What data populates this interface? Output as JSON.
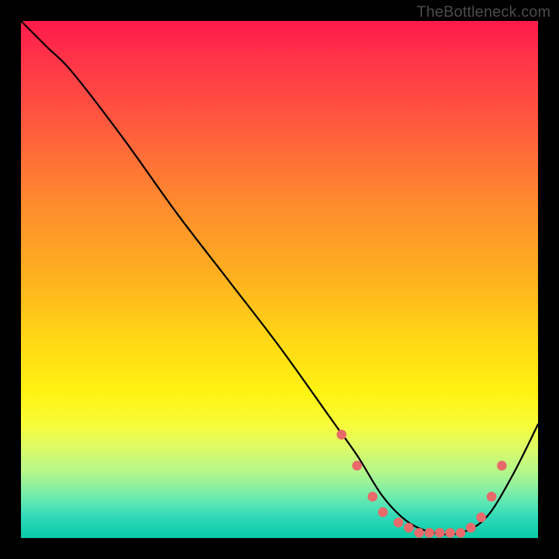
{
  "watermark": "TheBottleneck.com",
  "chart_data": {
    "type": "line",
    "title": "",
    "xlabel": "",
    "ylabel": "",
    "xlim": [
      0,
      100
    ],
    "ylim": [
      0,
      100
    ],
    "grid": false,
    "legend": false,
    "series": [
      {
        "name": "bottleneck-curve",
        "color": "#000000",
        "x": [
          0,
          5,
          10,
          20,
          30,
          40,
          50,
          60,
          65,
          70,
          75,
          80,
          85,
          90,
          95,
          100
        ],
        "y": [
          100,
          95,
          90,
          77,
          63,
          50,
          37,
          23,
          16,
          8,
          3,
          1,
          1,
          4,
          12,
          22
        ]
      }
    ],
    "points": {
      "name": "highlight-points",
      "color": "#e86a6a",
      "radius": 7,
      "x": [
        62,
        65,
        68,
        70,
        73,
        75,
        77,
        79,
        81,
        83,
        85,
        87,
        89,
        91,
        93
      ],
      "y": [
        20,
        14,
        8,
        5,
        3,
        2,
        1,
        1,
        1,
        1,
        1,
        2,
        4,
        8,
        14
      ]
    },
    "gradient_stops": [
      {
        "pos": 0,
        "color": "#ff1a4b"
      },
      {
        "pos": 50,
        "color": "#ffd915"
      },
      {
        "pos": 100,
        "color": "#06c9a7"
      }
    ]
  }
}
